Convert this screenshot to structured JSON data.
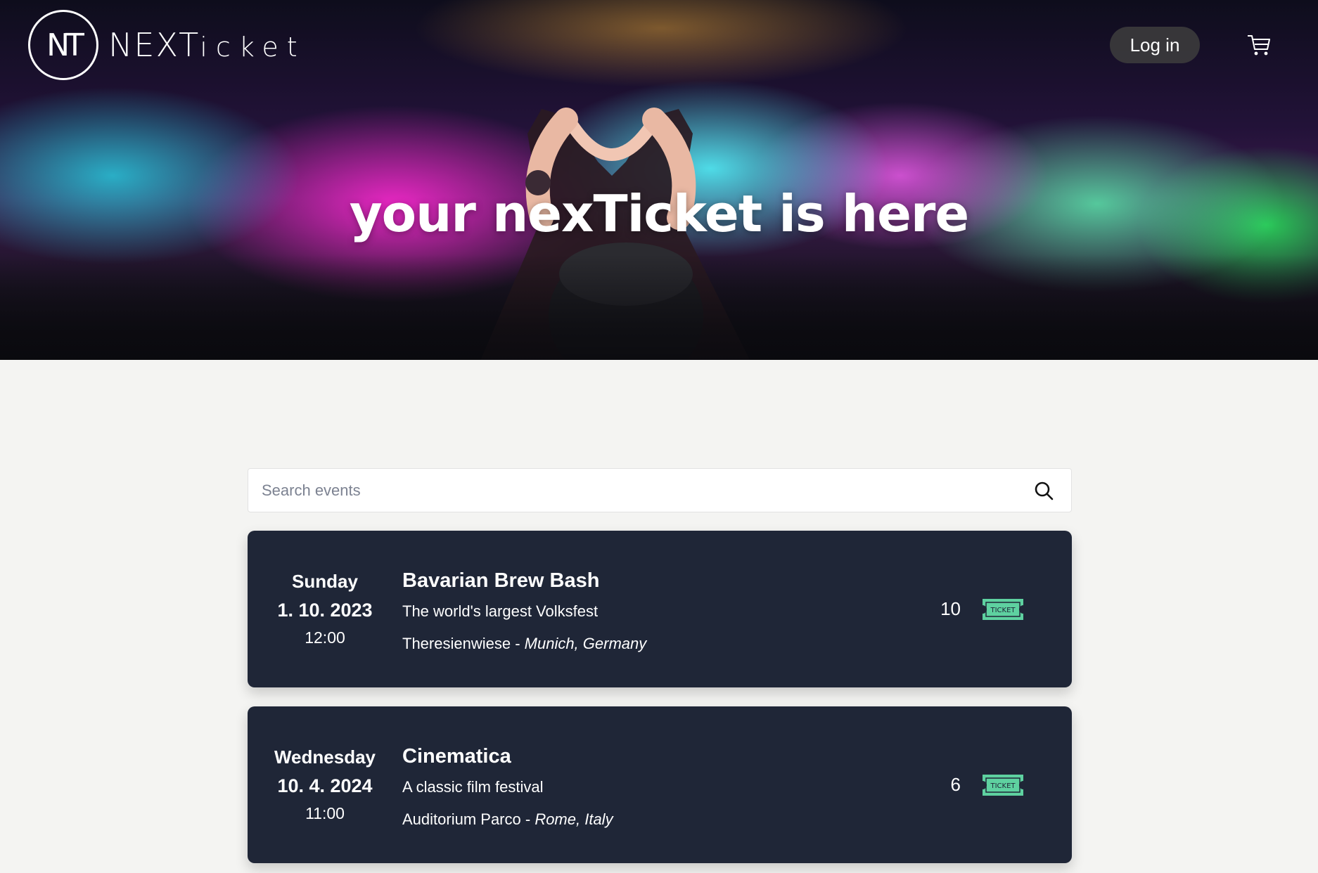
{
  "header": {
    "logo_mark": "NT",
    "logo_text_bold": "NEXT",
    "logo_text_light": "icket",
    "login_label": "Log in"
  },
  "hero": {
    "tagline": "your nexTicket is here"
  },
  "search": {
    "placeholder": "Search events"
  },
  "events": [
    {
      "day": "Sunday",
      "date": "1. 10. 2023",
      "time": "12:00",
      "title": "Bavarian Brew Bash",
      "subtitle": "The world's largest Volksfest",
      "venue": "Theresienwiese",
      "separator": " - ",
      "city": "Munich, Germany",
      "tickets": "10"
    },
    {
      "day": "Wednesday",
      "date": "10. 4. 2024",
      "time": "11:00",
      "title": "Cinematica",
      "subtitle": "A classic film festival",
      "venue": "Auditorium Parco",
      "separator": " - ",
      "city": "Rome, Italy",
      "tickets": "6"
    }
  ],
  "icons": {
    "cart": "cart-icon",
    "search": "search-icon",
    "ticket": "ticket-icon",
    "ticket_label": "TICKET"
  },
  "colors": {
    "card_bg": "#1f2637",
    "ticket_green": "#5ed1a0",
    "page_bg": "#f4f4f2"
  }
}
